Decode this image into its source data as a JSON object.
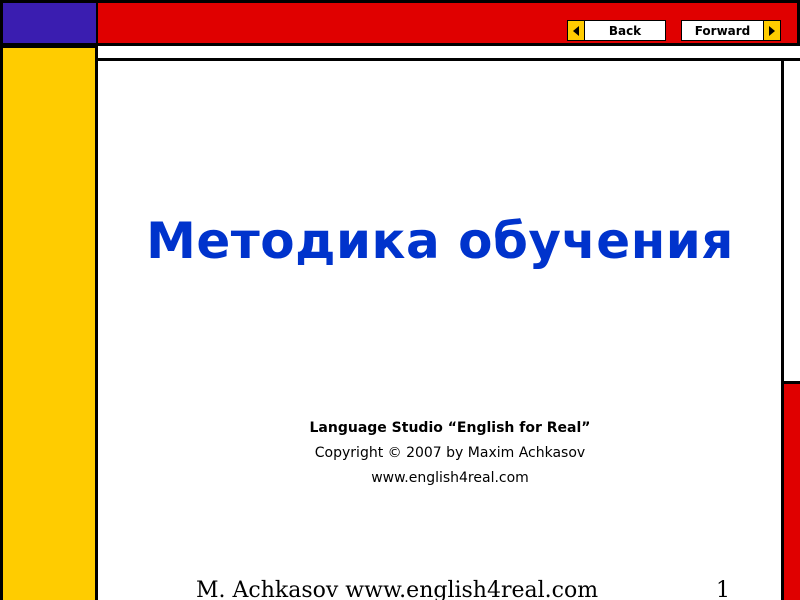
{
  "nav": {
    "back_label": "Back",
    "forward_label": "Forward"
  },
  "slide": {
    "title": "Методика обучения",
    "studio": "Language Studio “English for Real”",
    "copyright": "Copyright © 2007 by Maxim Achkasov",
    "website": "www.english4real.com"
  },
  "footer": {
    "text": "M. Achkasov www.english4real.com",
    "page_number": "1"
  },
  "colors": {
    "title": "#0033cc",
    "red": "#e00000",
    "yellow": "#ffcc00",
    "blue": "#3a1db0"
  }
}
